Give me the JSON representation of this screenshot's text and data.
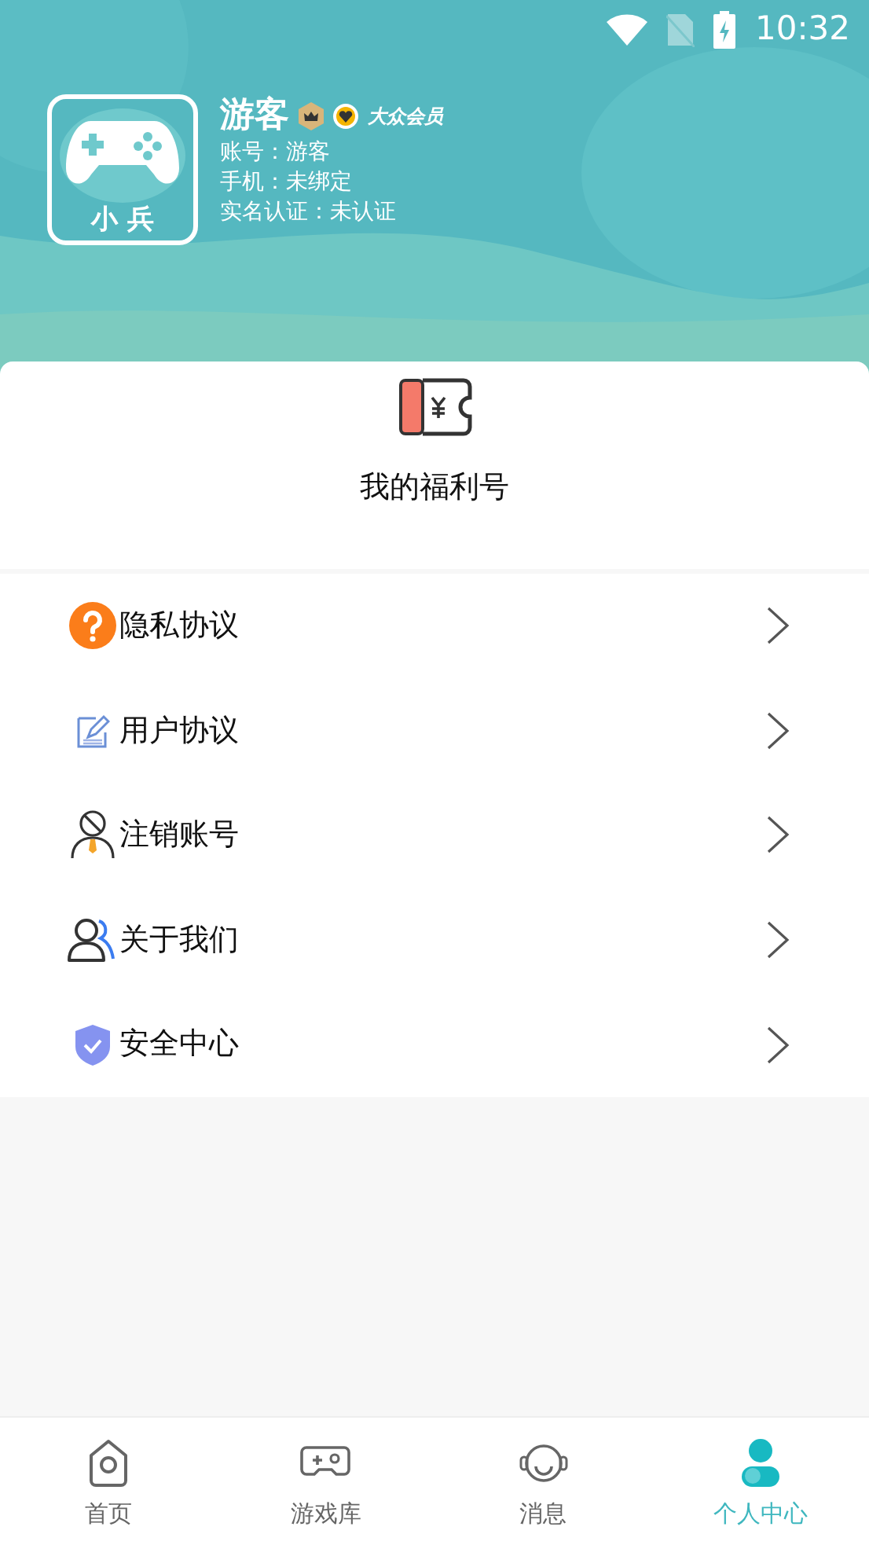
{
  "status_bar": {
    "time": "10:32"
  },
  "profile": {
    "avatar_label": "小 兵",
    "name": "游客",
    "member_badge": "大众会员",
    "details": [
      "账号：游客",
      "手机：未绑定",
      "实名认证：未认证"
    ]
  },
  "welfare": {
    "label": "我的福利号"
  },
  "menu": [
    {
      "label": "隐私协议"
    },
    {
      "label": "用户协议"
    },
    {
      "label": "注销账号"
    },
    {
      "label": "关于我们"
    },
    {
      "label": "安全中心"
    }
  ],
  "tabs": [
    {
      "label": "首页",
      "selected": false
    },
    {
      "label": "游戏库",
      "selected": false
    },
    {
      "label": "消息",
      "selected": false
    },
    {
      "label": "个人中心",
      "selected": true
    }
  ]
}
